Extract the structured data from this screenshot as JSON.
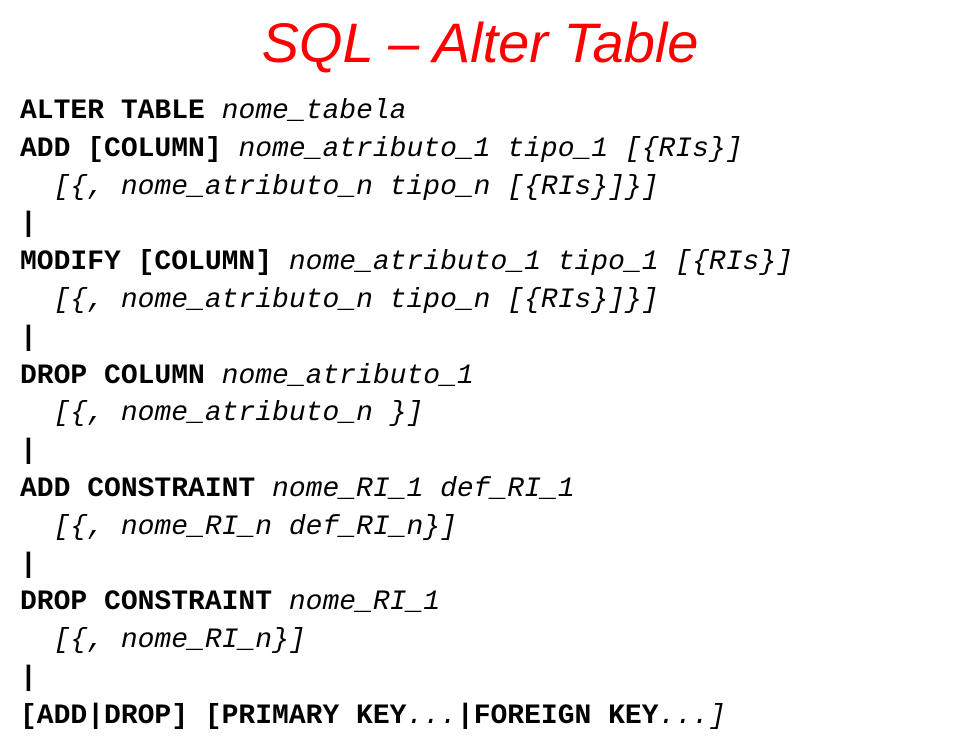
{
  "title": "SQL – Alter Table",
  "lines": [
    {
      "segments": [
        {
          "t": "ALTER TABLE ",
          "k": true
        },
        {
          "t": "nome_tabela",
          "i": true
        }
      ]
    },
    {
      "segments": [
        {
          "t": "ADD [COLUMN] ",
          "k": true
        },
        {
          "t": "nome_atributo_1 tipo_1 [{RIs}]",
          "i": true
        }
      ]
    },
    {
      "segments": [
        {
          "t": "  [{, ",
          "i": true
        },
        {
          "t": "nome_atributo_n tipo_n [{RIs}]",
          "i": true
        },
        {
          "t": "}]",
          "i": true
        }
      ]
    },
    {
      "segments": [
        {
          "t": "|",
          "k": true
        }
      ]
    },
    {
      "segments": [
        {
          "t": "MODIFY [COLUMN] ",
          "k": true
        },
        {
          "t": "nome_atributo_1 tipo_1 [{RIs}]",
          "i": true
        }
      ]
    },
    {
      "segments": [
        {
          "t": "  [{, ",
          "i": true
        },
        {
          "t": "nome_atributo_n tipo_n [{RIs}]",
          "i": true
        },
        {
          "t": "}]",
          "i": true
        }
      ]
    },
    {
      "segments": [
        {
          "t": "|",
          "k": true
        }
      ]
    },
    {
      "segments": [
        {
          "t": "DROP COLUMN ",
          "k": true
        },
        {
          "t": "nome_atributo_1",
          "i": true
        }
      ]
    },
    {
      "segments": [
        {
          "t": "  [{, ",
          "i": true
        },
        {
          "t": "nome_atributo_n ",
          "i": true
        },
        {
          "t": "}]",
          "i": true
        }
      ]
    },
    {
      "segments": [
        {
          "t": "|",
          "k": true
        }
      ]
    },
    {
      "segments": [
        {
          "t": "ADD CONSTRAINT ",
          "k": true
        },
        {
          "t": "nome_RI_1 def_RI_1",
          "i": true
        }
      ]
    },
    {
      "segments": [
        {
          "t": "  [{, ",
          "i": true
        },
        {
          "t": "nome_RI_n def_RI_n",
          "i": true
        },
        {
          "t": "}]",
          "i": true
        }
      ]
    },
    {
      "segments": [
        {
          "t": "|",
          "k": true
        }
      ]
    },
    {
      "segments": [
        {
          "t": "DROP CONSTRAINT ",
          "k": true
        },
        {
          "t": "nome_RI_1",
          "i": true
        }
      ]
    },
    {
      "segments": [
        {
          "t": "  [{, ",
          "i": true
        },
        {
          "t": "nome_RI_n",
          "i": true
        },
        {
          "t": "}]",
          "i": true
        }
      ]
    },
    {
      "segments": [
        {
          "t": "|",
          "k": true
        }
      ]
    },
    {
      "segments": [
        {
          "t": "[ADD|DROP] [PRIMARY KEY",
          "k": true
        },
        {
          "t": "...",
          "i": true
        },
        {
          "t": "|FOREIGN KEY",
          "k": true
        },
        {
          "t": "...]",
          "i": true
        }
      ]
    }
  ]
}
